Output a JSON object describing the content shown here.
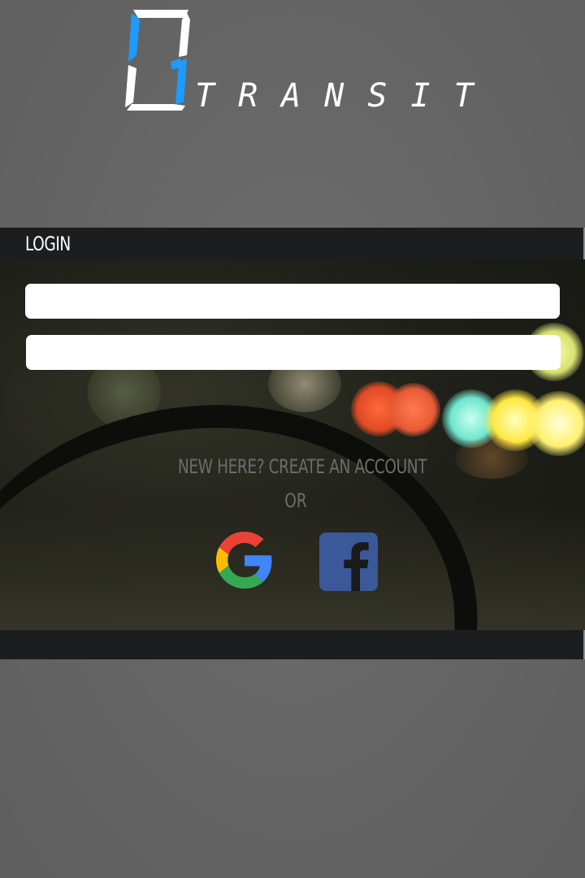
{
  "brand": {
    "word": "TRANSIT",
    "logo_icon": "digital-01-icon",
    "accent_color": "#1e9bff",
    "logo_color": "#ffffff"
  },
  "login": {
    "title": "LOGIN",
    "username_value": "",
    "username_placeholder": "",
    "password_value": "",
    "password_placeholder": "",
    "signup_text": "NEW HERE? CREATE AN ACCOUNT",
    "or_text": "OR",
    "social": [
      {
        "name": "google",
        "icon": "google-icon"
      },
      {
        "name": "facebook",
        "icon": "facebook-icon",
        "color": "#3b5998"
      }
    ]
  },
  "colors": {
    "bar": "#1c1d1f",
    "page": "#666666",
    "muted_text": "#6d6d6d"
  }
}
